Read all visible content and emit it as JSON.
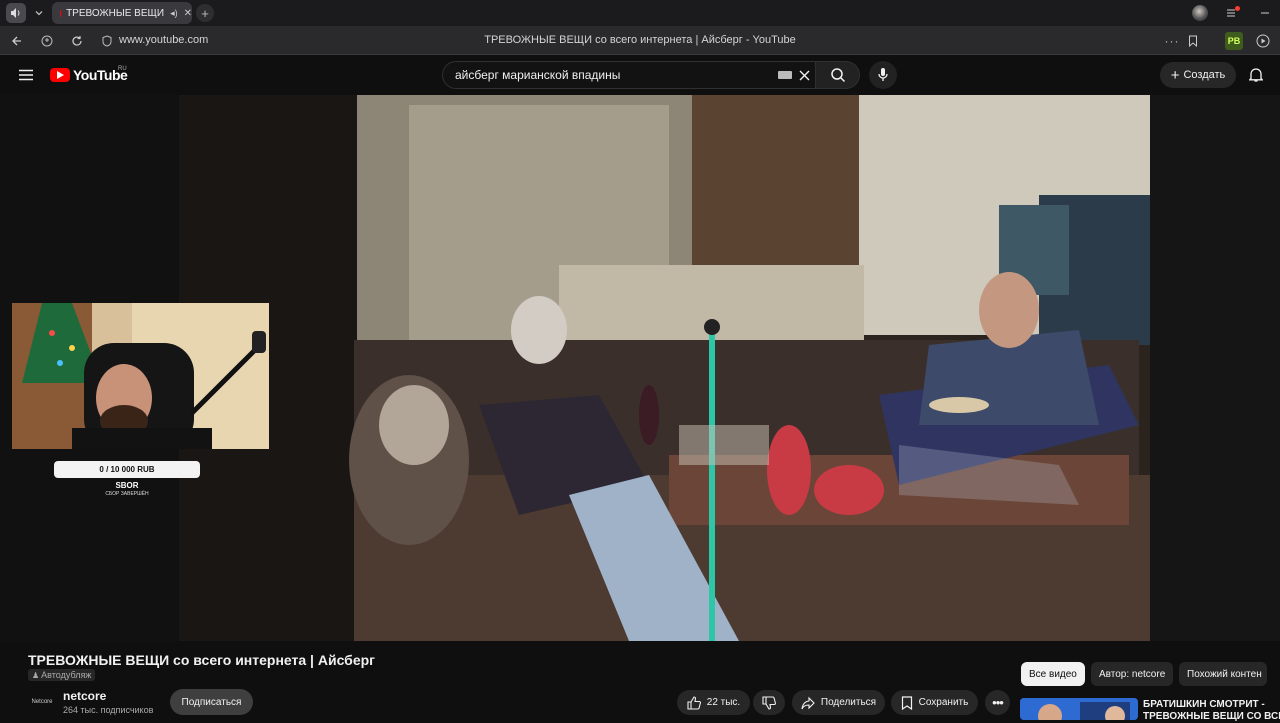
{
  "browser": {
    "tab_title": "ТРЕВОЖНЫЕ ВЕЩИ",
    "url": "www.youtube.com",
    "page_title": "ТРЕВОЖНЫЕ ВЕЩИ со всего интернета | Айсберг - YouTube",
    "extension_badge": "PB"
  },
  "youtube": {
    "logo_text": "YouTube",
    "region": "RU",
    "search_value": "айсберг марианской впадины",
    "create_label": "Создать"
  },
  "overlay": {
    "donation_text": "0 / 10 000 RUB",
    "donation_progress": 0,
    "donation_name": "SBOR",
    "donation_status": "СБОР ЗАВЕРШЁН"
  },
  "video": {
    "title": "ТРЕВОЖНЫЕ ВЕЩИ со всего интернета | Айсберг",
    "dub_label": "Автодубляж",
    "channel_avatar_text": "Netcore",
    "channel_name": "netcore",
    "subscribers": "264 тыс. подписчиков",
    "subscribe_label": "Подписаться",
    "likes": "22 тыс.",
    "share_label": "Поделиться",
    "save_label": "Сохранить"
  },
  "chips": {
    "all": "Все видео",
    "author": "Автор: netcore",
    "similar": "Похожий контен"
  },
  "recommendation": {
    "title_line1": "БРАТИШКИН СМОТРИТ -",
    "title_line2": "ТРЕВОЖНЫЕ ВЕЩИ СО ВСЕГО"
  },
  "colors": {
    "background": "#0f0f0f",
    "youtube_red": "#ff0000",
    "chip_active": "#f1f1f1"
  }
}
